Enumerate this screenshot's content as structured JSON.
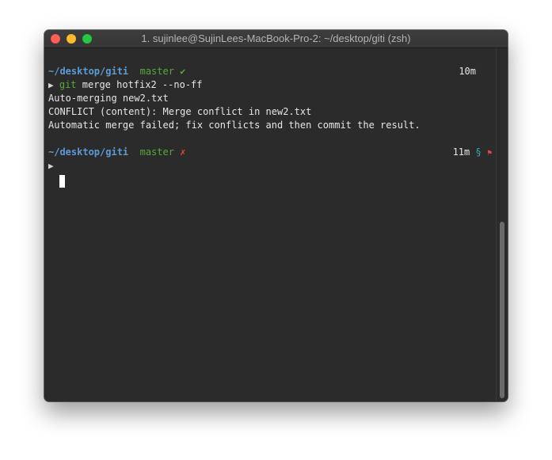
{
  "window": {
    "title": "1. sujinlee@SujinLees-MacBook-Pro-2: ~/desktop/giti (zsh)"
  },
  "prompt1": {
    "path": "~/desktop/giti",
    "branch": "master",
    "status_icon": "✔",
    "elapsed": "10m"
  },
  "command1": {
    "arrow": "▶",
    "program": "git",
    "args": "merge hotfix2 --no-ff"
  },
  "output": [
    "Auto-merging new2.txt",
    "CONFLICT (content): Merge conflict in new2.txt",
    "Automatic merge failed; fix conflicts and then commit the result."
  ],
  "prompt2": {
    "path": "~/desktop/giti",
    "branch": "master",
    "status_icon": "✗",
    "elapsed": "11m",
    "stash_icon": "§",
    "flag_icon": "⚑"
  },
  "command2": {
    "arrow": "▶"
  },
  "colors": {
    "path": "#5c9bd6",
    "branch": "#57a93b",
    "error": "#e04848",
    "stash": "#2fa9b8",
    "background": "#2b2b2b"
  },
  "icons": {
    "close": "close-icon",
    "minimize": "minimize-icon",
    "zoom": "zoom-icon"
  }
}
